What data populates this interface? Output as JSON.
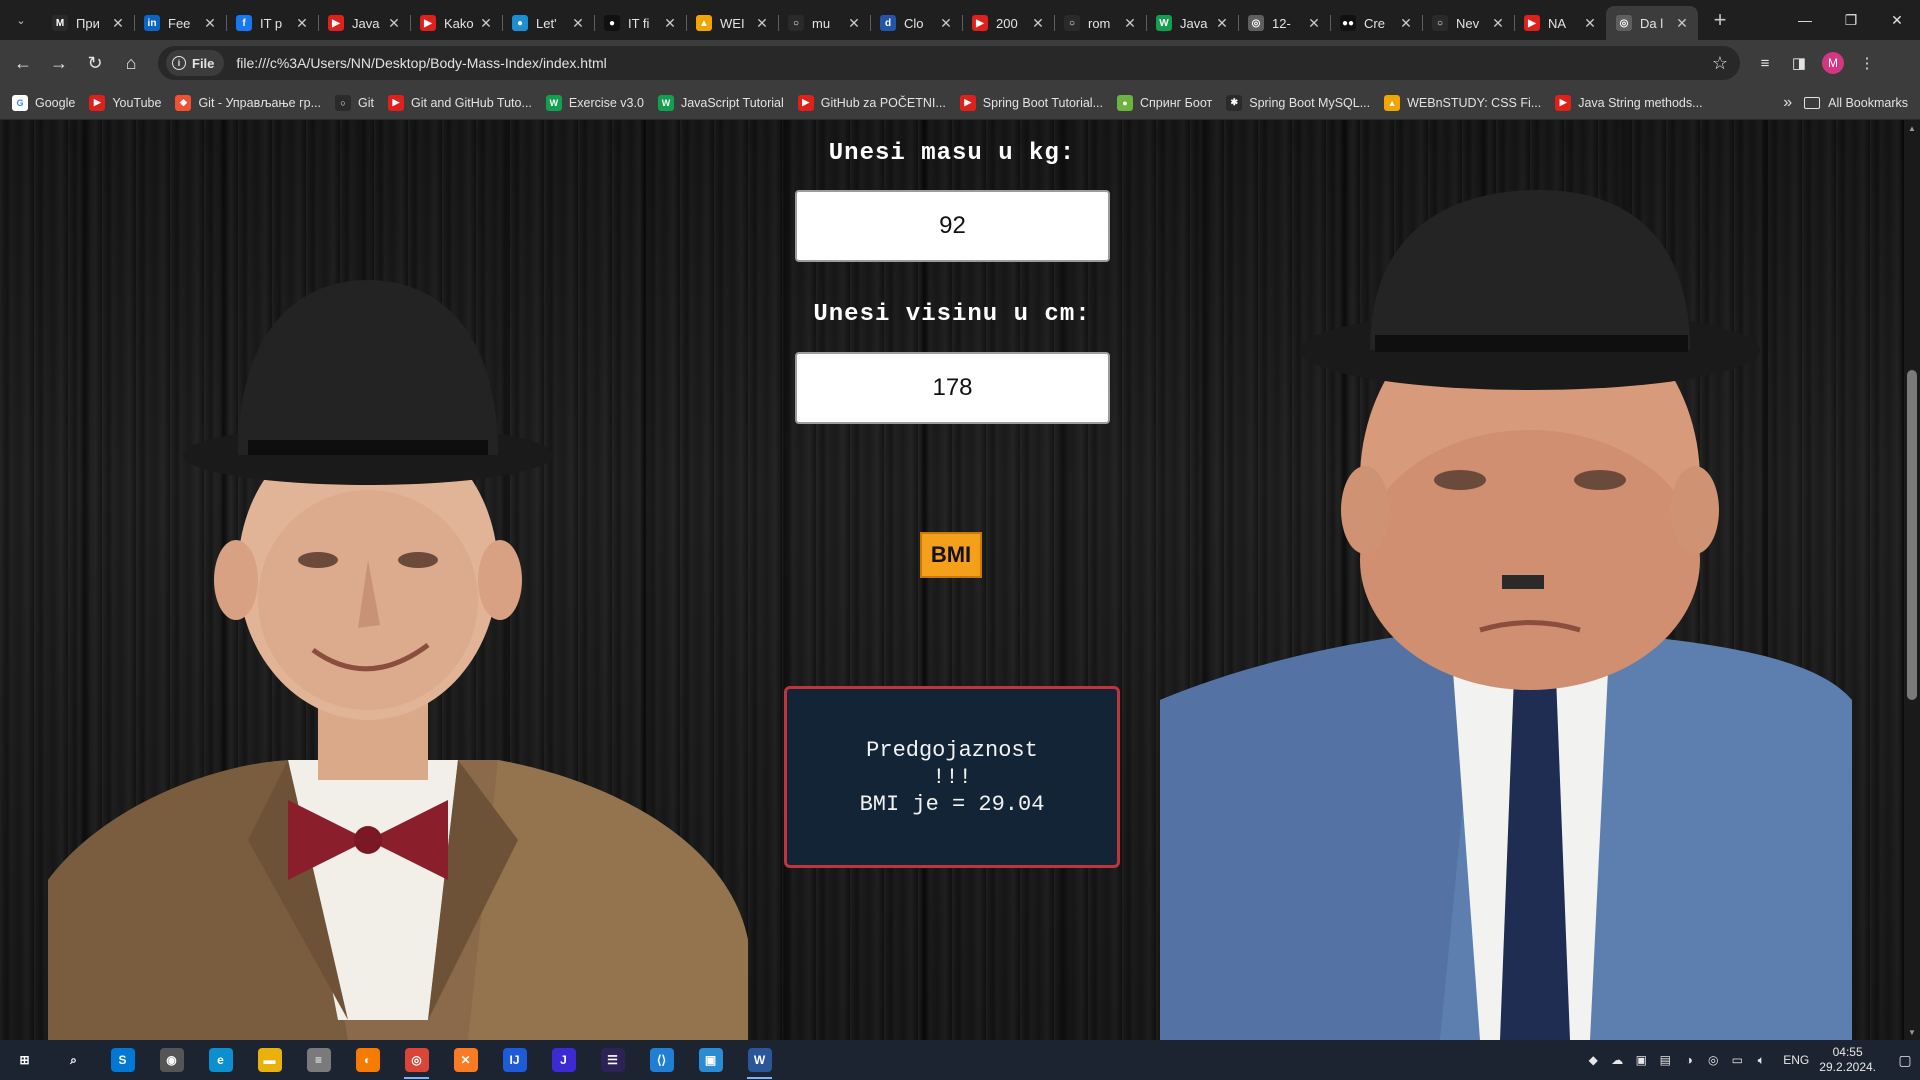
{
  "browser": {
    "tabs": [
      {
        "title": "При",
        "favicon_color": "#2a2a2a",
        "favicon_glyph": "M",
        "favicon_name": "gmail-icon"
      },
      {
        "title": "Fee",
        "favicon_color": "#0a66c2",
        "favicon_glyph": "in",
        "favicon_name": "linkedin-icon"
      },
      {
        "title": "IT p",
        "favicon_color": "#1877f2",
        "favicon_glyph": "f",
        "favicon_name": "facebook-icon"
      },
      {
        "title": "Java",
        "favicon_color": "#e0201b",
        "favicon_glyph": "▶",
        "favicon_name": "youtube-icon"
      },
      {
        "title": "Kako",
        "favicon_color": "#e0201b",
        "favicon_glyph": "▶",
        "favicon_name": "youtube-icon"
      },
      {
        "title": "Let'",
        "favicon_color": "#1b8fd1",
        "favicon_glyph": "●",
        "favicon_name": "site-icon"
      },
      {
        "title": "IT fi",
        "favicon_color": "#111111",
        "favicon_glyph": "●",
        "favicon_name": "site-icon"
      },
      {
        "title": "WEI",
        "favicon_color": "#f0a500",
        "favicon_glyph": "▲",
        "favicon_name": "webnstudy-icon"
      },
      {
        "title": "mu",
        "favicon_color": "#2a2a2a",
        "favicon_glyph": "○",
        "favicon_name": "github-icon"
      },
      {
        "title": "Clo",
        "favicon_color": "#2356a6",
        "favicon_glyph": "d",
        "favicon_name": "site-icon"
      },
      {
        "title": "200",
        "favicon_color": "#e0201b",
        "favicon_glyph": "▶",
        "favicon_name": "youtube-icon"
      },
      {
        "title": "rom",
        "favicon_color": "#2a2a2a",
        "favicon_glyph": "○",
        "favicon_name": "github-icon"
      },
      {
        "title": "Java",
        "favicon_color": "#12a050",
        "favicon_glyph": "W",
        "favicon_name": "w3schools-icon"
      },
      {
        "title": "12-",
        "favicon_color": "#5f5f5f",
        "favicon_glyph": "◎",
        "favicon_name": "site-icon"
      },
      {
        "title": "Cre",
        "favicon_color": "#111111",
        "favicon_glyph": "●●",
        "favicon_name": "medium-icon"
      },
      {
        "title": "Nev",
        "favicon_color": "#2a2a2a",
        "favicon_glyph": "○",
        "favicon_name": "github-icon"
      },
      {
        "title": "NA",
        "favicon_color": "#e0201b",
        "favicon_glyph": "▶",
        "favicon_name": "youtube-icon"
      },
      {
        "title": "Da l",
        "favicon_color": "#5f5f5f",
        "favicon_glyph": "◎",
        "favicon_name": "page-icon",
        "active": true
      }
    ],
    "address": {
      "chip": "File",
      "url": "file:///c%3A/Users/NN/Desktop/Body-Mass-Index/index.html"
    },
    "profile_initial": "M",
    "bookmarks": [
      {
        "label": "Google",
        "color": "#ffffff",
        "glyph": "G",
        "icon": "google-icon"
      },
      {
        "label": "YouTube",
        "color": "#e0201b",
        "glyph": "▶",
        "icon": "youtube-icon"
      },
      {
        "label": "Git - Управљање гр...",
        "color": "#f05033",
        "glyph": "◆",
        "icon": "git-icon"
      },
      {
        "label": "Git",
        "color": "#2a2a2a",
        "glyph": "○",
        "icon": "github-icon"
      },
      {
        "label": "Git and GitHub Tuto...",
        "color": "#e0201b",
        "glyph": "▶",
        "icon": "youtube-icon"
      },
      {
        "label": "Exercise v3.0",
        "color": "#12a050",
        "glyph": "W",
        "icon": "w3schools-icon"
      },
      {
        "label": "JavaScript Tutorial",
        "color": "#12a050",
        "glyph": "W",
        "icon": "w3schools-icon"
      },
      {
        "label": "GitHub za POČETNI...",
        "color": "#e0201b",
        "glyph": "▶",
        "icon": "youtube-icon"
      },
      {
        "label": "Spring Boot Tutorial...",
        "color": "#e0201b",
        "glyph": "▶",
        "icon": "youtube-icon"
      },
      {
        "label": "Спринг Боот",
        "color": "#6db33f",
        "glyph": "●",
        "icon": "spring-icon"
      },
      {
        "label": "Spring Boot MySQL...",
        "color": "#2a2a2a",
        "glyph": "✱",
        "icon": "site-icon"
      },
      {
        "label": "WEBnSTUDY: CSS Fi...",
        "color": "#f0a500",
        "glyph": "▲",
        "icon": "webnstudy-icon"
      },
      {
        "label": "Java String methods...",
        "color": "#e0201b",
        "glyph": "▶",
        "icon": "youtube-icon"
      }
    ],
    "all_bookmarks_label": "All Bookmarks"
  },
  "page": {
    "mass_label": "Unesi masu u kg:",
    "mass_value": "92",
    "height_label": "Unesi visinu u cm:",
    "height_value": "178",
    "button_label": "BMI",
    "result_line1": "Predgojaznost",
    "result_line2": "!!!",
    "result_line3": "BMI je = 29.04"
  },
  "taskbar": {
    "apps": [
      {
        "name": "start-icon",
        "color": "#1c2431",
        "glyph": "⊞"
      },
      {
        "name": "search-icon",
        "color": "#1c2431",
        "glyph": "⌕"
      },
      {
        "name": "skype-icon",
        "color": "#0078d4",
        "glyph": "S"
      },
      {
        "name": "camera-app-icon",
        "color": "#555555",
        "glyph": "◉"
      },
      {
        "name": "edge-icon",
        "color": "#0c8fcf",
        "glyph": "e"
      },
      {
        "name": "file-explorer-icon",
        "color": "#e8b10c",
        "glyph": "▬"
      },
      {
        "name": "database-icon",
        "color": "#7a7a7a",
        "glyph": "≡"
      },
      {
        "name": "blender-icon",
        "color": "#f57c00",
        "glyph": "◐"
      },
      {
        "name": "chrome-icon",
        "color": "#db4437",
        "glyph": "◎",
        "active": true
      },
      {
        "name": "xampp-icon",
        "color": "#fb7a24",
        "glyph": "✕"
      },
      {
        "name": "intellij-icon",
        "color": "#1e5bd8",
        "glyph": "IJ"
      },
      {
        "name": "jetbrains-icon",
        "color": "#3b2bd4",
        "glyph": "J"
      },
      {
        "name": "eclipse-icon",
        "color": "#2c2255",
        "glyph": "☰"
      },
      {
        "name": "vscode-icon",
        "color": "#1f7fd4",
        "glyph": "⟨⟩"
      },
      {
        "name": "remote-desktop-icon",
        "color": "#2a8dd4",
        "glyph": "▣"
      },
      {
        "name": "word-icon",
        "color": "#2b579a",
        "glyph": "W",
        "active": true
      }
    ],
    "language": "ENG",
    "time": "04:55",
    "date": "29.2.2024."
  }
}
